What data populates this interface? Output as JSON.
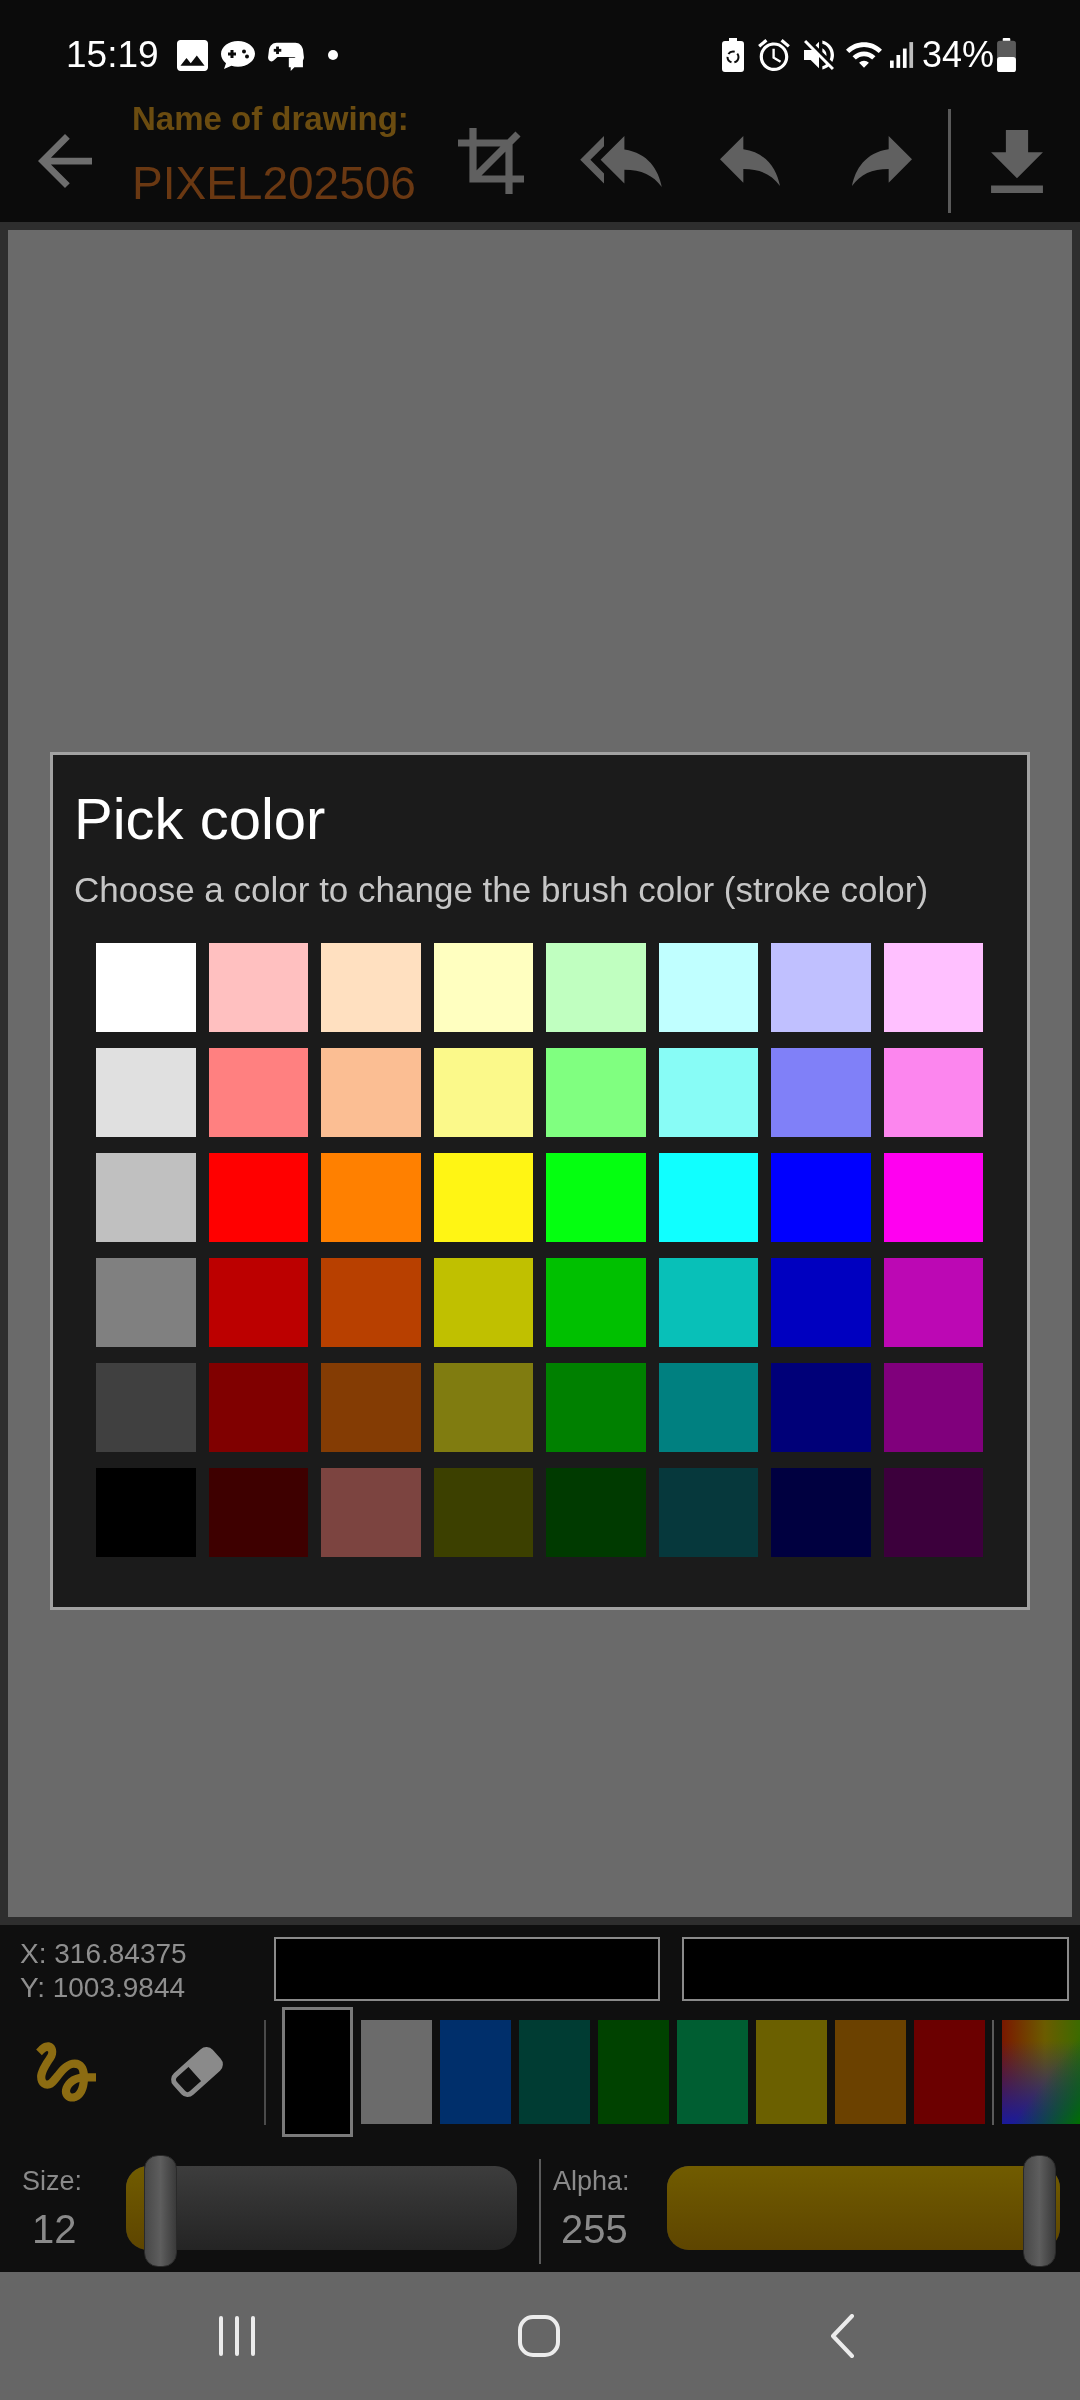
{
  "status_bar": {
    "time": "15:19",
    "battery": "34%"
  },
  "toolbar": {
    "label": "Name of drawing:",
    "drawing_name": "PIXEL202506"
  },
  "dialog": {
    "title": "Pick color",
    "message": "Choose a color to change the brush color (stroke color)",
    "swatch_rows": [
      {
        "swatches": [
          {
            "color": "#ffffff"
          },
          {
            "color": "#ffc0c0"
          },
          {
            "color": "#ffe0c0"
          },
          {
            "color": "#ffffc0"
          },
          {
            "color": "#c0ffc0"
          },
          {
            "color": "#c0ffff"
          },
          {
            "color": "#c0c0ff"
          },
          {
            "color": "#ffc0ff"
          }
        ]
      },
      {
        "swatches": [
          {
            "color": "#e0e0e0"
          },
          {
            "color": "#ff8080"
          },
          {
            "color": "#fbbe93"
          },
          {
            "color": "#fbf98a"
          },
          {
            "color": "#80ff80"
          },
          {
            "color": "#88fcf6"
          },
          {
            "color": "#8080f8"
          },
          {
            "color": "#fc86ee"
          }
        ]
      },
      {
        "swatches": [
          {
            "color": "#c0c0c0"
          },
          {
            "color": "#ff0000"
          },
          {
            "color": "#ff8000"
          },
          {
            "color": "#fff514"
          },
          {
            "color": "#04ff10"
          },
          {
            "color": "#10ffff"
          },
          {
            "color": "#0000ff"
          },
          {
            "color": "#ff00f0"
          }
        ]
      },
      {
        "swatches": [
          {
            "color": "#808080"
          },
          {
            "color": "#bc0000"
          },
          {
            "color": "#b84000"
          },
          {
            "color": "#c0c000"
          },
          {
            "color": "#00c000"
          },
          {
            "color": "#08c0b8"
          },
          {
            "color": "#0000c0"
          },
          {
            "color": "#bc08b4"
          }
        ]
      },
      {
        "swatches": [
          {
            "color": "#404040"
          },
          {
            "color": "#800000"
          },
          {
            "color": "#843c04"
          },
          {
            "color": "#807c10"
          },
          {
            "color": "#008000"
          },
          {
            "color": "#008080"
          },
          {
            "color": "#000078"
          },
          {
            "color": "#80007c"
          }
        ]
      },
      {
        "swatches": [
          {
            "color": "#000000"
          },
          {
            "color": "#3e0000"
          },
          {
            "color": "#7c4440"
          },
          {
            "color": "#3c4000"
          },
          {
            "color": "#003a00"
          },
          {
            "color": "#06383c"
          },
          {
            "color": "#000040"
          },
          {
            "color": "#3c003c"
          }
        ]
      }
    ]
  },
  "coordinates": {
    "x": "X: 316.84375",
    "y": "Y: 1003.9844"
  },
  "color_previews": [
    {
      "color": "#000000"
    },
    {
      "color": "#000000"
    }
  ],
  "tools": [
    {
      "kind": "brush",
      "selected": true
    },
    {
      "kind": "eraser",
      "selected": false
    }
  ],
  "palette": [
    {
      "color": "#000000",
      "selected": true
    },
    {
      "color": "#6b6b6b",
      "selected": false
    },
    {
      "color": "#002f6b",
      "selected": false
    },
    {
      "color": "#003c33",
      "selected": false
    },
    {
      "color": "#004200",
      "selected": false
    },
    {
      "color": "#005e32",
      "selected": false
    },
    {
      "color": "#6b6000",
      "selected": false
    },
    {
      "color": "#6b4100",
      "selected": false
    },
    {
      "color": "#6b0000",
      "selected": false
    }
  ],
  "sliders": [
    {
      "label": "Size:",
      "value": "12",
      "level": 0.045
    },
    {
      "label": "Alpha:",
      "value": "255",
      "level": 1
    }
  ]
}
